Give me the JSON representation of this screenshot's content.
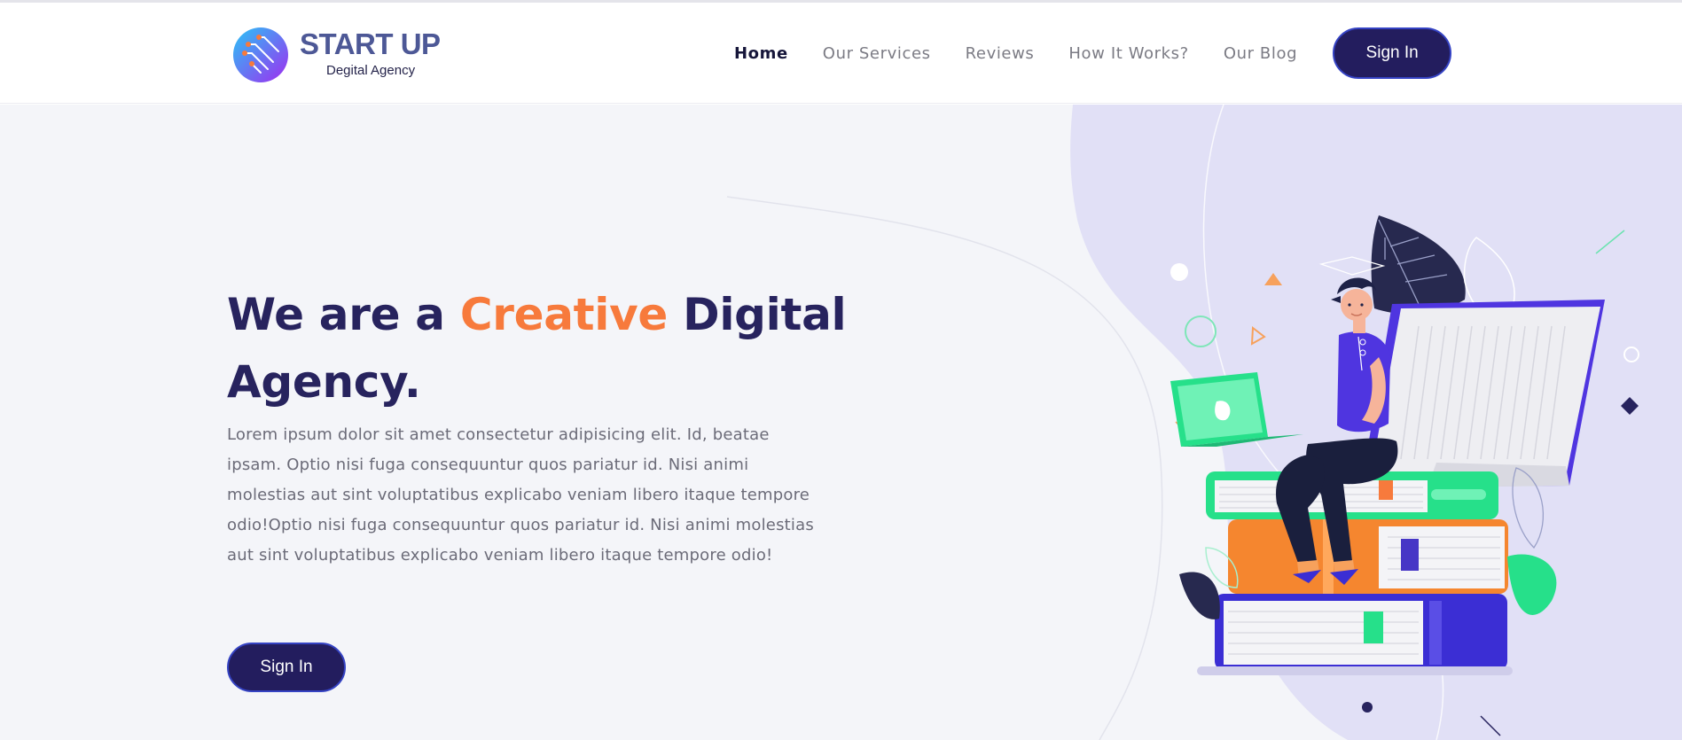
{
  "brand": {
    "name": "START UP",
    "tagline": "Degital Agency",
    "gradient_start": "#29c5f6",
    "gradient_end": "#a02cf0"
  },
  "nav": {
    "items": [
      {
        "label": "Home",
        "active": true
      },
      {
        "label": "Our Services",
        "active": false
      },
      {
        "label": "Reviews",
        "active": false
      },
      {
        "label": "How It Works?",
        "active": false
      },
      {
        "label": "Our Blog",
        "active": false
      }
    ],
    "signin_label": "Sign In"
  },
  "hero": {
    "headline_prefix": "We are a ",
    "headline_accent": "Creative",
    "headline_suffix": " Digital Agency.",
    "body": "Lorem ipsum dolor sit amet consectetur adipisicing elit. Id, beatae ipsam. Optio nisi fuga consequuntur quos pariatur id. Nisi animi molestias aut sint voluptatibus explicabo veniam libero itaque tempore odio!Optio nisi fuga consequuntur quos pariatur id. Nisi animi molestias aut sint voluptatibus explicabo veniam libero itaque tempore odio!",
    "cta_label": "Sign In"
  },
  "colors": {
    "primary": "#231d5e",
    "accent": "#f77a3c",
    "headline": "#27235e",
    "hero_bg": "#f4f5f9",
    "blob": "#e1e0f6",
    "button_border": "#3543c4"
  },
  "illustration": {
    "subject": "person-with-laptop-on-books-illustration"
  }
}
